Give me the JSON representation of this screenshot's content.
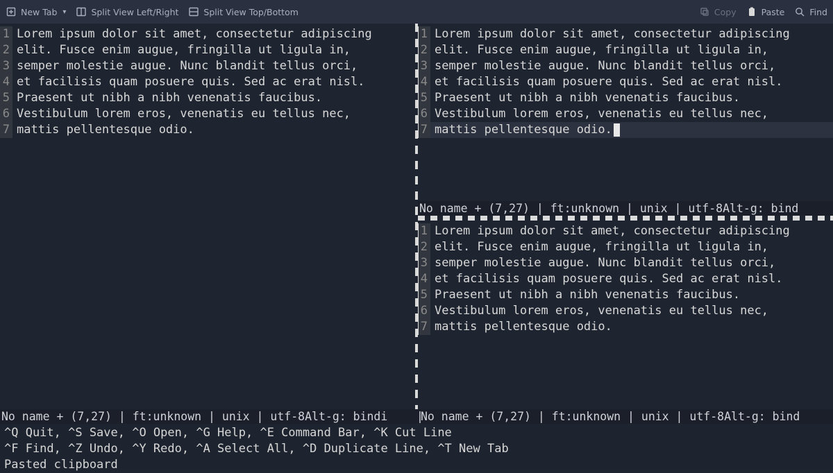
{
  "toolbar": {
    "new_tab": "New Tab",
    "split_lr": "Split View Left/Right",
    "split_tb": "Split View Top/Bottom",
    "copy": "Copy",
    "paste": "Paste",
    "find": "Find"
  },
  "buffer_lines": [
    "Lorem ipsum dolor sit amet, consectetur adipiscing",
    "elit. Fusce enim augue, fringilla ut ligula in,",
    "semper molestie augue. Nunc blandit tellus orci,",
    "et facilisis quam posuere quis. Sed ac erat nisl.",
    "Praesent ut nibh a nibh venenatis faucibus.",
    "Vestibulum lorem eros, venenatis eu tellus nec,",
    "mattis pellentesque odio."
  ],
  "status": {
    "left_full": "No name + (7,27) | ft:unknown | unix | utf-8Alt-g: bindi",
    "right_top": "No name + (7,27) | ft:unknown | unix | utf-8Alt-g: bind",
    "right_bot": "No name + (7,27) | ft:unknown | unix | utf-8Alt-g: bind"
  },
  "footer": {
    "kb1": "^Q Quit, ^S Save, ^O Open, ^G Help, ^E Command Bar, ^K Cut Line",
    "kb2": "^F Find, ^Z Undo, ^Y Redo, ^A Select All, ^D Duplicate Line, ^T New Tab",
    "msg": "Pasted clipboard"
  }
}
